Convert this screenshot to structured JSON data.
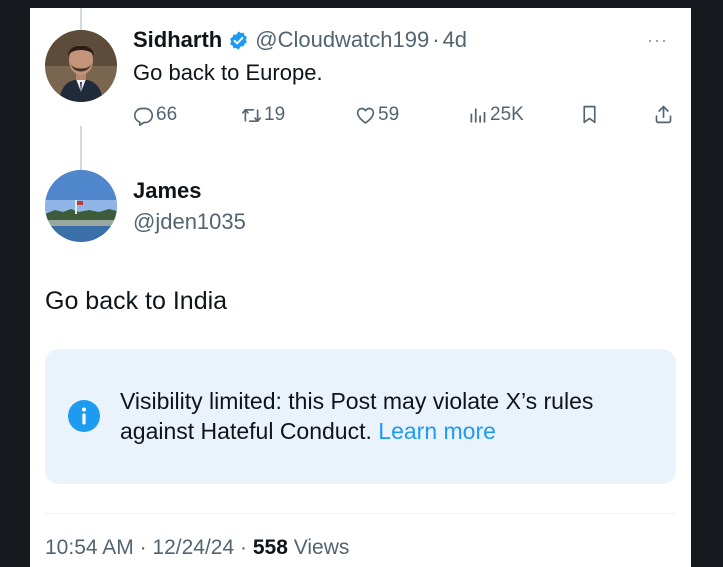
{
  "reply_post": {
    "author_name": "Sidharth",
    "author_handle": "@Cloudwatch199",
    "separator": "·",
    "age": "4d",
    "text": "Go back to Europe.",
    "more_glyph": "···",
    "actions": {
      "replies": "66",
      "reposts": "19",
      "likes": "59",
      "views": "25K"
    },
    "verified": true
  },
  "main_post": {
    "author_name": "James",
    "author_handle": "@jden1035",
    "text": "Go back to India",
    "notice": {
      "text": "Visibility limited: this Post may violate X’s rules against Hateful Conduct.",
      "link_label": "Learn more"
    },
    "meta": {
      "time": "10:54 AM",
      "separator": "·",
      "date": "12/24/24",
      "views_count": "558",
      "views_label": "Views"
    }
  },
  "icons": [
    "verified-badge-icon",
    "more-icon",
    "reply-icon",
    "repost-icon",
    "like-icon",
    "views-icon",
    "bookmark-icon",
    "share-icon",
    "info-icon"
  ],
  "colors": {
    "accent": "#1d9bf0",
    "text_primary": "#0f1419",
    "text_secondary": "#536471",
    "notice_background": "#eaf2fb"
  }
}
